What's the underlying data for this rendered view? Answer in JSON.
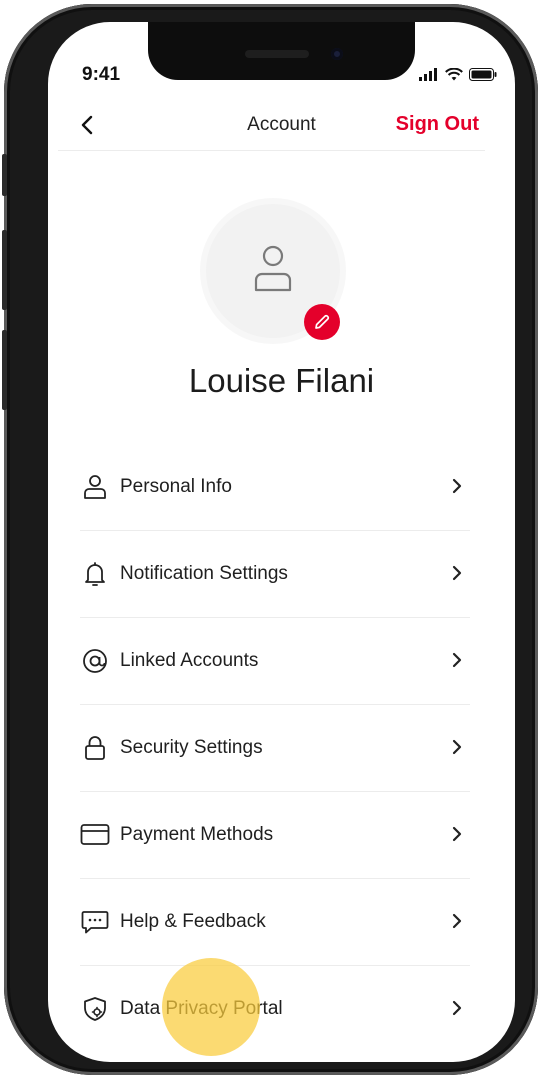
{
  "status_bar": {
    "time": "9:41"
  },
  "nav": {
    "title": "Account",
    "sign_out": "Sign Out"
  },
  "profile": {
    "name": "Louise Filani"
  },
  "menu": {
    "items": [
      {
        "label": "Personal Info",
        "icon": "person-icon"
      },
      {
        "label": "Notification Settings",
        "icon": "bell-icon"
      },
      {
        "label": "Linked Accounts",
        "icon": "at-sign-icon"
      },
      {
        "label": "Security Settings",
        "icon": "lock-icon"
      },
      {
        "label": "Payment Methods",
        "icon": "credit-card-icon"
      },
      {
        "label": "Help & Feedback",
        "icon": "chat-bubble-icon"
      },
      {
        "label": "Data Privacy Portal",
        "icon": "shield-gear-icon"
      }
    ]
  },
  "colors": {
    "accent": "#e4002b",
    "tap_indicator": "#facc3c"
  }
}
